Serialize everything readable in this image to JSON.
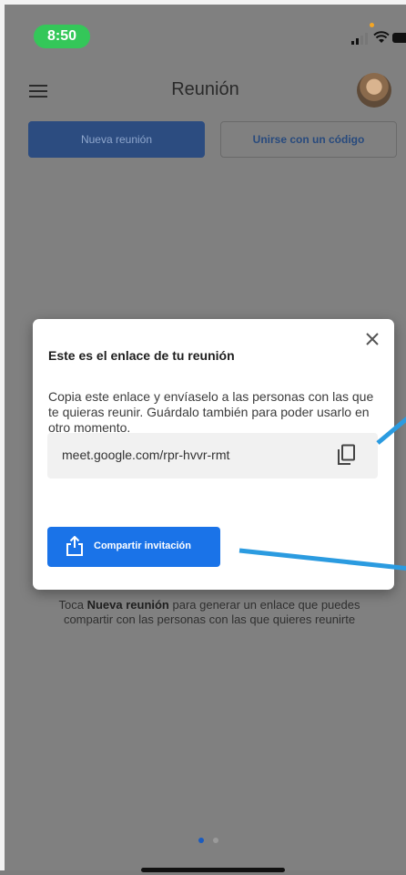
{
  "status_bar": {
    "time": "8:50"
  },
  "app_bar": {
    "title": "Reunión"
  },
  "actions": {
    "new_meeting": "Nueva reunión",
    "join_with_code": "Unirse con un código"
  },
  "dialog": {
    "title": "Este es el enlace de tu reunión",
    "body": "Copia este enlace y envíaselo a las personas con las que te quieras reunir. Guárdalo también para poder usarlo en otro momento.",
    "link": "meet.google.com/rpr-hvvr-rmt",
    "share_button": "Compartir invitación"
  },
  "hint": {
    "prefix": "Toca ",
    "bold": "Nueva reunión",
    "suffix": " para generar un enlace que puedes compartir con las personas con las que quieres reunirte"
  },
  "colors": {
    "accent": "#1a73e8",
    "time_pill": "#34c759",
    "annotation": "#2b9be0"
  },
  "icons": [
    "menu-icon",
    "close-icon",
    "copy-icon",
    "share-icon",
    "wifi-icon",
    "battery-icon",
    "signal-icon"
  ]
}
